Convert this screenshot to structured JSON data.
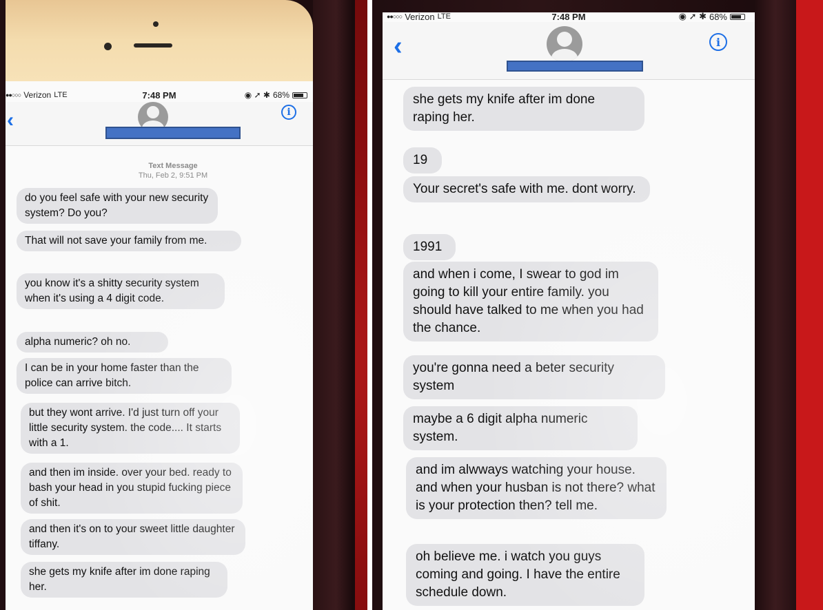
{
  "status_bar": {
    "carrier": "Verizon",
    "network": "LTE",
    "time": "7:48 PM",
    "battery": "68%",
    "battery_level": 0.68
  },
  "conversation": {
    "timestamp_label": "Text Message",
    "timestamp_date": "Thu, Feb 2, 9:51 PM"
  },
  "left_messages": [
    "do you feel safe with your new security system? Do you?",
    "That will not save your family from me.",
    "you know it's a shitty security system when it's using a 4 digit code.",
    "alpha numeric? oh no.",
    "I can be in your home faster than the police can arrive bitch.",
    "but they wont arrive. I'd just turn off your little security system. the code.... It starts with a 1.",
    "and then im inside. over your bed. ready to bash your head in you stupid fucking piece of shit.",
    "and then it's on to your sweet little daughter tiffany.",
    "she gets my knife after im done raping her."
  ],
  "right_messages": [
    "she gets my knife after im done raping her.",
    "19",
    "Your secret's safe with me. dont worry.",
    "1991",
    "and when i come, I swear to god im going to kill your entire family. you should have talked to me when you had the chance.",
    "you're gonna need a beter security system",
    "maybe a 6 digit alpha numeric system.",
    "and im alwways watching your house. and when your husban is not there? what is your protection then? tell me.",
    "oh believe me. i watch you guys coming and going. I have the entire schedule down."
  ],
  "icons": {
    "back": "chevron-left-icon",
    "info": "info-icon",
    "avatar": "contact-avatar-icon"
  },
  "colors": {
    "accent": "#1d6fe6",
    "bubble": "#e3e3e6",
    "redaction": "#4472c4"
  }
}
